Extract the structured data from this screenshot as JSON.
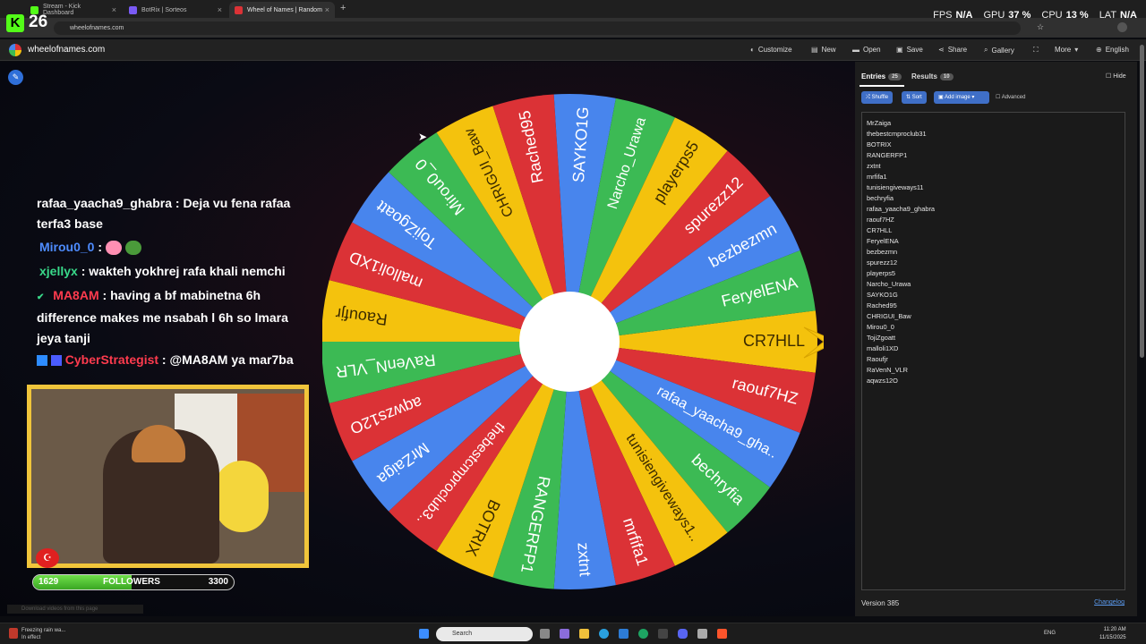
{
  "browser": {
    "tabs": [
      {
        "label": "Stream - Kick Dashboard",
        "color": "#53fc18"
      },
      {
        "label": "BotRix | Sorteos",
        "color": "#7a5af5"
      },
      {
        "label": "Wheel of Names | Random",
        "color": "#db3236"
      }
    ],
    "new_tab": "+",
    "url": "wheelofnames.com"
  },
  "overlay": {
    "logo_letter": "K",
    "counter": "26",
    "stats": [
      {
        "key": "FPS",
        "value": "N/A"
      },
      {
        "key": "GPU",
        "value": "37 %"
      },
      {
        "key": "CPU",
        "value": "13 %"
      },
      {
        "key": "LAT",
        "value": "N/A"
      }
    ]
  },
  "site": {
    "name": "wheelofnames.com",
    "menu": [
      {
        "label": "Customize",
        "icon": "palette-icon",
        "glyph": "◐"
      },
      {
        "label": "New",
        "icon": "new-file-icon",
        "glyph": "▤"
      },
      {
        "label": "Open",
        "icon": "folder-icon",
        "glyph": "▬"
      },
      {
        "label": "Save",
        "icon": "save-icon",
        "glyph": "▣"
      },
      {
        "label": "Share",
        "icon": "share-icon",
        "glyph": "⋖"
      },
      {
        "label": "Gallery",
        "icon": "search-icon",
        "glyph": "⌕"
      },
      {
        "label": "",
        "icon": "fullscreen-icon",
        "glyph": "⛶"
      },
      {
        "label": "More",
        "icon": "chevron-down-icon",
        "glyph": "▾"
      },
      {
        "label": "English",
        "icon": "globe-icon",
        "glyph": "⊕"
      }
    ]
  },
  "chat": [
    {
      "user": "rafaa_yaacha9_ghabra",
      "user_color": "#ffffff",
      "text": " : Deja vu fena rafaa",
      "cont": "terfa3 base"
    },
    {
      "user": "Mirou0_0",
      "user_color": "#4e8cff",
      "text": " :",
      "cont": ""
    },
    {
      "user": "xjellyx",
      "user_color": "#39d98a",
      "text": " : wakteh yokhrej rafa khali nemchi",
      "cont": ""
    },
    {
      "user": "MA8AM",
      "user_color": "#ff3b4e",
      "text": " : having a bf mabinetna 6h",
      "cont": "difference makes me nsabah l 6h so lmara",
      "cont2": "jeya tanji"
    },
    {
      "user": "CyberStrategist",
      "user_color": "#ff3b4e",
      "text": " : @MA8AM ya mar7ba",
      "cont": ""
    }
  ],
  "followers": {
    "current": "1629",
    "label": "FOLLOWERS",
    "goal": "3300",
    "progress": 0.49
  },
  "download_note": "Download videos from this page",
  "wheel": {
    "pointer_color": "#f4c20d",
    "segments": [
      {
        "name": "CR7HLL",
        "color": "#f4c20d"
      },
      {
        "name": "raouf7HZ",
        "color": "#db3236"
      },
      {
        "name": "rafaa_yaacha9_gha..",
        "color": "#4885ed"
      },
      {
        "name": "bechryfia",
        "color": "#3cba54"
      },
      {
        "name": "tunisiengiveways1..",
        "color": "#f4c20d"
      },
      {
        "name": "mrfifa1",
        "color": "#db3236"
      },
      {
        "name": "zxtnt",
        "color": "#4885ed"
      },
      {
        "name": "RANGERFP1",
        "color": "#3cba54"
      },
      {
        "name": "BOTRIX",
        "color": "#f4c20d"
      },
      {
        "name": "thebestcmproclub3..",
        "color": "#db3236"
      },
      {
        "name": "MrZaiga",
        "color": "#4885ed"
      },
      {
        "name": "aqwzs12O",
        "color": "#db3236"
      },
      {
        "name": "RaVenN_VLR",
        "color": "#3cba54"
      },
      {
        "name": "Raoufjr",
        "color": "#f4c20d"
      },
      {
        "name": "malloli1XD",
        "color": "#db3236"
      },
      {
        "name": "TojiZgoatt",
        "color": "#4885ed"
      },
      {
        "name": "Mirou0_0",
        "color": "#3cba54"
      },
      {
        "name": "CHRIGUI_Baw",
        "color": "#f4c20d"
      },
      {
        "name": "Rached95",
        "color": "#db3236"
      },
      {
        "name": "SAYKO1G",
        "color": "#4885ed"
      },
      {
        "name": "Narcho_Urawa",
        "color": "#3cba54"
      },
      {
        "name": "playerps5",
        "color": "#f4c20d"
      },
      {
        "name": "spurezz12",
        "color": "#db3236"
      },
      {
        "name": "bezbezmn",
        "color": "#4885ed"
      },
      {
        "name": "FeryelENA",
        "color": "#3cba54"
      }
    ]
  },
  "panel": {
    "tab_entries": "Entries",
    "entries_count": "25",
    "tab_results": "Results",
    "results_count": "10",
    "hide": "Hide",
    "shuffle": "Shuffle",
    "sort": "Sort",
    "add_image": "Add image",
    "advanced": "Advanced",
    "entries": [
      "MrZaiga",
      "thebestcmproclub31",
      "BOTRIX",
      "RANGERFP1",
      "zxtnt",
      "mrfifa1",
      "tunisiengiveways11",
      "bechryfia",
      "rafaa_yaacha9_ghabra",
      "raouf7HZ",
      "CR7HLL",
      "FeryelENA",
      "bezbezmn",
      "spurezz12",
      "playerps5",
      "Narcho_Urawa",
      "SAYKO1G",
      "Rached95",
      "CHRIGUI_Baw",
      "Mirou0_0",
      "TojiZgoatt",
      "malloli1XD",
      "Raoufjr",
      "RaVenN_VLR",
      "aqwzs12O"
    ],
    "version": "Version 385",
    "changelog": "Changelog"
  },
  "taskbar": {
    "weather_line1": "Freezing rain wa...",
    "weather_line2": "In effect",
    "search": "Search",
    "lang": "ENG",
    "time": "11:20 AM",
    "date": "11/15/2025"
  }
}
